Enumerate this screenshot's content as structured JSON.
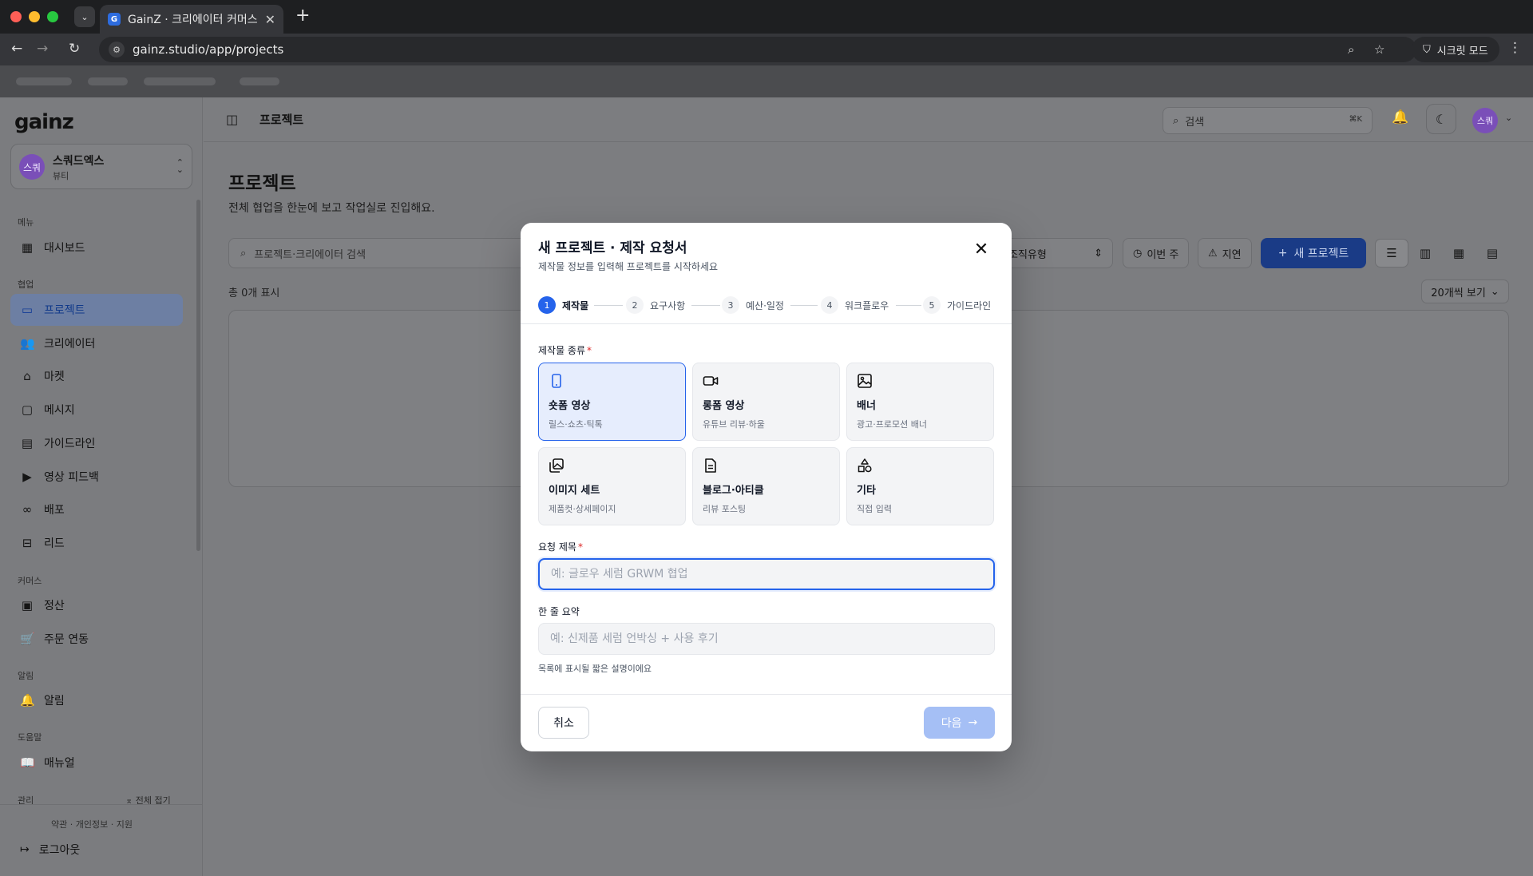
{
  "browser": {
    "tab_title": "GainZ · 크리에이터 커머스 협업 OS",
    "favicon_letter": "G",
    "url": "gainz.studio/app/projects",
    "incognito_label": "시크릿 모드"
  },
  "sidebar": {
    "logo": "gainz",
    "workspace": {
      "avatar": "스쿼",
      "name": "스쿼드엑스",
      "category": "뷰티"
    },
    "sections": {
      "menu": "메뉴",
      "collab": "협업",
      "commerce": "커머스",
      "alerts": "알림",
      "help": "도움말",
      "admin": "관리"
    },
    "items": {
      "dashboard": "대시보드",
      "projects": "프로젝트",
      "creators": "크리에이터",
      "market": "마켓",
      "messages": "메시지",
      "guidelines": "가이드라인",
      "video_feedback": "영상 피드백",
      "distribution": "배포",
      "leads": "리드",
      "settlement": "정산",
      "orders": "주문 연동",
      "notifications": "알림",
      "manual": "매뉴얼"
    },
    "collapse_all": "전체 접기",
    "footer_links": "약관 · 개인정보 · 지원",
    "logout": "로그아웃"
  },
  "topbar": {
    "title": "프로젝트",
    "search_placeholder": "검색",
    "search_shortcut": "⌘K",
    "user_avatar": "스쿼"
  },
  "page": {
    "title": "프로젝트",
    "subtitle": "전체 협업을 한눈에 보고 작업실로 진입해요.",
    "search_placeholder": "프로젝트·크리에이터 검색",
    "filter_org_type": "조직유형",
    "filter_this_week": "이번 주",
    "filter_delayed": "지연",
    "new_project": "새 프로젝트",
    "count_text": "총 0개 표시",
    "per_page": "20개씩 보기"
  },
  "modal": {
    "title": "새 프로젝트 · 제작 요청서",
    "subtitle": "제작물 정보를 입력해 프로젝트를 시작하세요",
    "steps": [
      {
        "num": "1",
        "label": "제작물"
      },
      {
        "num": "2",
        "label": "요구사항"
      },
      {
        "num": "3",
        "label": "예산·일정"
      },
      {
        "num": "4",
        "label": "워크플로우"
      },
      {
        "num": "5",
        "label": "가이드라인"
      }
    ],
    "type_label": "제작물 종류",
    "required_mark": "*",
    "types": [
      {
        "title": "숏폼 영상",
        "sub": "릴스·쇼츠·틱톡",
        "icon": "phone-icon"
      },
      {
        "title": "롱폼 영상",
        "sub": "유튜브 리뷰·하울",
        "icon": "video-camera-icon"
      },
      {
        "title": "배너",
        "sub": "광고·프로모션 배너",
        "icon": "image-icon"
      },
      {
        "title": "이미지 세트",
        "sub": "제품컷·상세페이지",
        "icon": "images-icon"
      },
      {
        "title": "블로그·아티클",
        "sub": "리뷰 포스팅",
        "icon": "document-icon"
      },
      {
        "title": "기타",
        "sub": "직접 입력",
        "icon": "shapes-icon"
      }
    ],
    "title_label": "요청 제목",
    "title_placeholder": "예: 글로우 세럼 GRWM 협업",
    "title_value": "",
    "summary_label": "한 줄 요약",
    "summary_placeholder": "예: 신제품 세럼 언박싱 + 사용 후기",
    "summary_value": "",
    "summary_hint": "목록에 표시될 짧은 설명이에요",
    "cancel": "취소",
    "next": "다음"
  },
  "colors": {
    "accent": "#2563eb",
    "next_disabled": "#a5bff5",
    "avatar": "#7a4fb8",
    "required": "#dc2626"
  }
}
